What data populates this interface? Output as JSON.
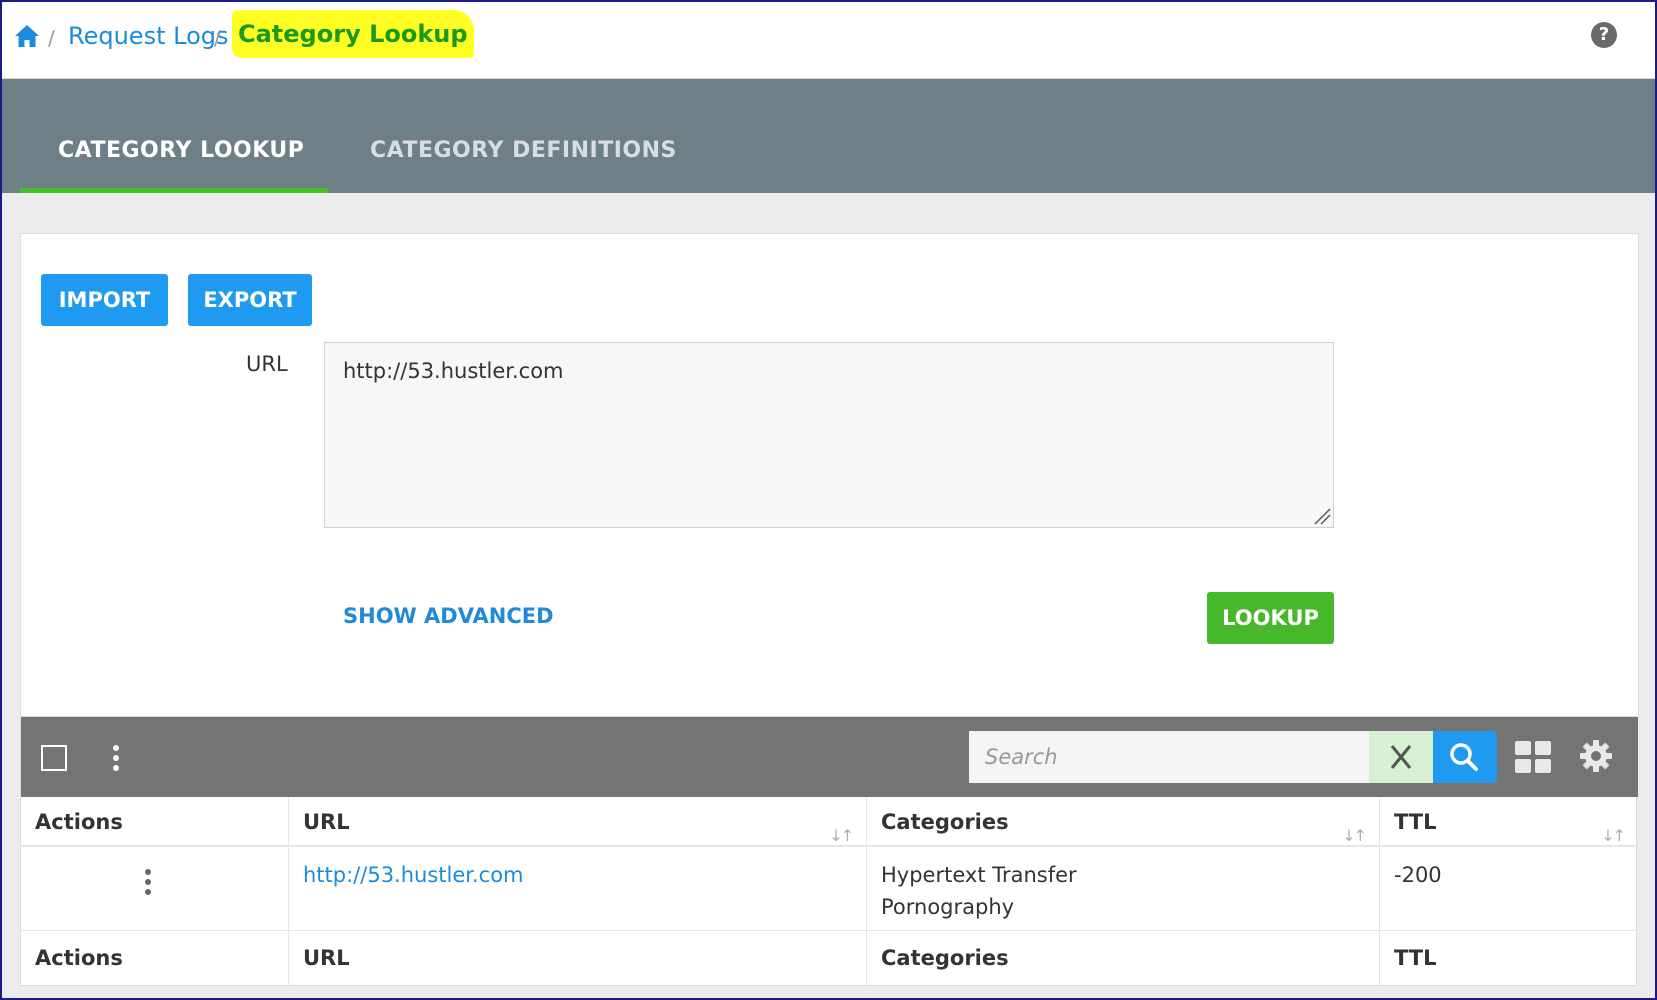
{
  "breadcrumb": {
    "home_icon": "home-icon",
    "separator": "/",
    "parent": "Request Logs",
    "current": "Category Lookup"
  },
  "help_icon": "question-circle-icon",
  "tabs": [
    {
      "label": "CATEGORY LOOKUP",
      "active": true
    },
    {
      "label": "CATEGORY DEFINITIONS",
      "active": false
    }
  ],
  "actions": {
    "import_label": "IMPORT",
    "export_label": "EXPORT"
  },
  "form": {
    "url_label": "URL",
    "url_value": "http://53.hustler.com",
    "show_advanced_label": "SHOW ADVANCED",
    "lookup_label": "LOOKUP"
  },
  "grid": {
    "search_placeholder": "Search",
    "columns": [
      "Actions",
      "URL",
      "Categories",
      "TTL"
    ],
    "rows": [
      {
        "url": "http://53.hustler.com",
        "categories": [
          "Hypertext Transfer",
          "Pornography"
        ],
        "ttl": "-200"
      }
    ],
    "footer_columns": [
      "Actions",
      "URL",
      "Categories",
      "TTL"
    ]
  },
  "colors": {
    "link_blue": "#1a8cdb",
    "button_blue": "#1e9af0",
    "lookup_green": "#47b82a",
    "tab_bar": "#6f7f86",
    "active_tab_underline": "#47c02b",
    "highlight_yellow": "#ffff26"
  }
}
